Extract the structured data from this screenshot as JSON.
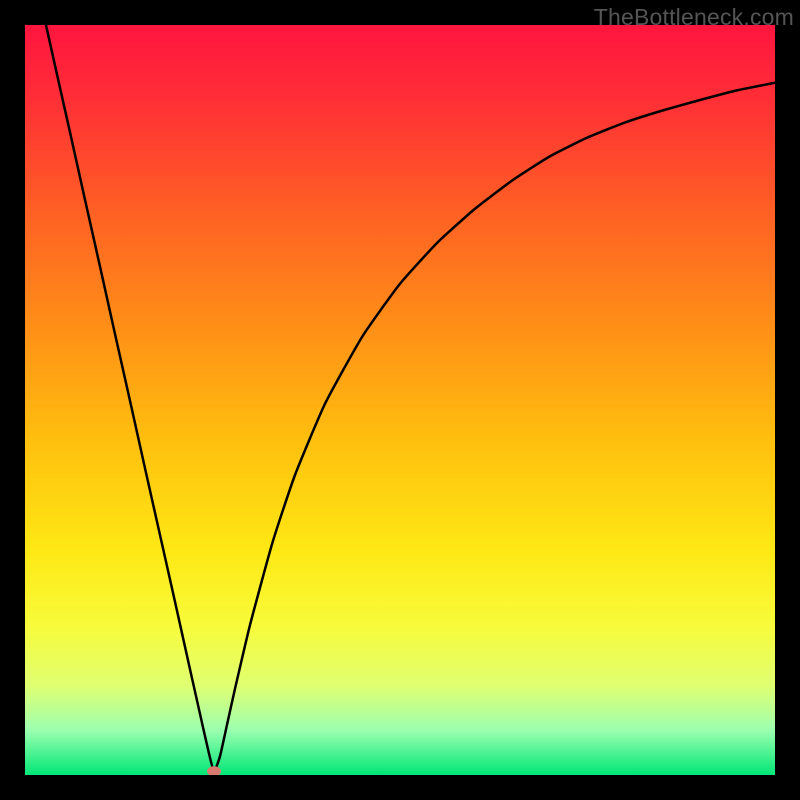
{
  "watermark": "TheBottleneck.com",
  "chart_data": {
    "type": "line",
    "title": "",
    "xlabel": "",
    "ylabel": "",
    "xlim": [
      0,
      100
    ],
    "ylim": [
      0,
      100
    ],
    "grid": false,
    "legend": false,
    "background_gradient": {
      "stops": [
        {
          "offset": 0.0,
          "color": "#ff153f"
        },
        {
          "offset": 0.1,
          "color": "#ff2f36"
        },
        {
          "offset": 0.25,
          "color": "#ff6024"
        },
        {
          "offset": 0.4,
          "color": "#ff8e17"
        },
        {
          "offset": 0.55,
          "color": "#ffbe0e"
        },
        {
          "offset": 0.7,
          "color": "#fee814"
        },
        {
          "offset": 0.8,
          "color": "#f8fb3a"
        },
        {
          "offset": 0.88,
          "color": "#e0ff70"
        },
        {
          "offset": 0.94,
          "color": "#9cffb0"
        },
        {
          "offset": 1.0,
          "color": "#00e676"
        }
      ]
    },
    "series": [
      {
        "name": "curve",
        "color": "#000000",
        "width": 2.5,
        "x": [
          2.8,
          4,
          6,
          8,
          10,
          12,
          14,
          16,
          18,
          20,
          22,
          23.5,
          24.5,
          25.2,
          26,
          27,
          28,
          30,
          33,
          36,
          40,
          45,
          50,
          55,
          60,
          65,
          70,
          75,
          80,
          85,
          90,
          95,
          100
        ],
        "y": [
          100,
          94.6,
          85.7,
          76.7,
          67.8,
          58.8,
          49.9,
          40.9,
          32.0,
          23.1,
          14.1,
          7.4,
          3.0,
          0.5,
          2.5,
          7.0,
          11.5,
          20.0,
          31.0,
          40.0,
          49.5,
          58.5,
          65.5,
          71.0,
          75.5,
          79.3,
          82.5,
          85.0,
          87.0,
          88.6,
          90.0,
          91.3,
          92.3
        ]
      }
    ],
    "marker": {
      "x": 25.2,
      "y": 0.5,
      "rx": 7,
      "ry": 5,
      "color": "#d87a6f"
    }
  }
}
